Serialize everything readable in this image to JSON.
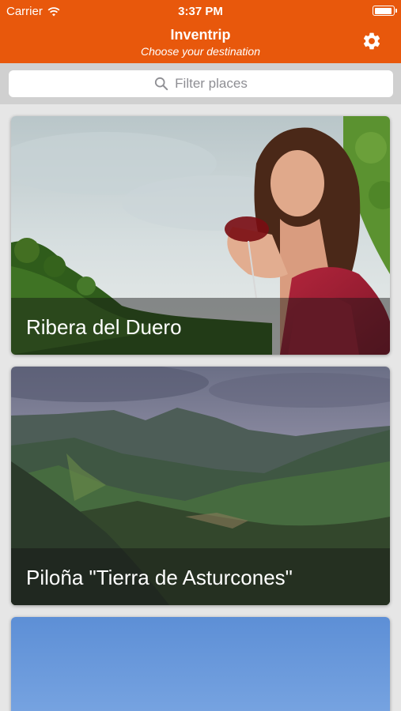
{
  "status_bar": {
    "carrier": "Carrier",
    "time": "3:37 PM",
    "battery_level": 0.95
  },
  "header": {
    "title": "Inventrip",
    "subtitle": "Choose your destination",
    "settings_icon": "gear-icon"
  },
  "search": {
    "placeholder": "Filter places",
    "icon": "search-icon"
  },
  "places": [
    {
      "name": "Ribera del Duero"
    },
    {
      "name": "Piloña \"Tierra de Asturcones\""
    },
    {
      "name": ""
    }
  ],
  "colors": {
    "accent": "#e8580c",
    "caption_overlay": "rgba(20,20,20,0.45)"
  }
}
